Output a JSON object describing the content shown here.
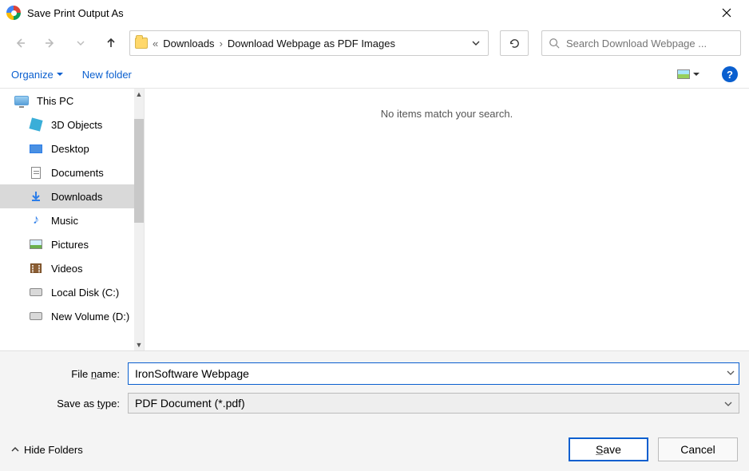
{
  "window": {
    "title": "Save Print Output As"
  },
  "nav": {
    "history_text": "«",
    "breadcrumb": [
      "Downloads",
      "Download Webpage as PDF Images"
    ],
    "search_placeholder": "Search Download Webpage ..."
  },
  "toolbar": {
    "organize": "Organize",
    "new_folder": "New folder"
  },
  "sidebar": {
    "items": [
      {
        "label": "This PC",
        "selected": false,
        "level": 0,
        "icon": "pc"
      },
      {
        "label": "3D Objects",
        "selected": false,
        "level": 1,
        "icon": "3d"
      },
      {
        "label": "Desktop",
        "selected": false,
        "level": 1,
        "icon": "desktop"
      },
      {
        "label": "Documents",
        "selected": false,
        "level": 1,
        "icon": "doc"
      },
      {
        "label": "Downloads",
        "selected": true,
        "level": 1,
        "icon": "dl"
      },
      {
        "label": "Music",
        "selected": false,
        "level": 1,
        "icon": "music"
      },
      {
        "label": "Pictures",
        "selected": false,
        "level": 1,
        "icon": "pic"
      },
      {
        "label": "Videos",
        "selected": false,
        "level": 1,
        "icon": "vid"
      },
      {
        "label": "Local Disk (C:)",
        "selected": false,
        "level": 1,
        "icon": "disk"
      },
      {
        "label": "New Volume (D:)",
        "selected": false,
        "level": 1,
        "icon": "disk"
      }
    ]
  },
  "content": {
    "empty_message": "No items match your search."
  },
  "form": {
    "filename_label": "File name:",
    "filename_value": "IronSoftware Webpage",
    "type_label": "Save as type:",
    "type_value": "PDF Document (*.pdf)"
  },
  "footer": {
    "hide_folders": "Hide Folders",
    "save": "Save",
    "cancel": "Cancel"
  }
}
